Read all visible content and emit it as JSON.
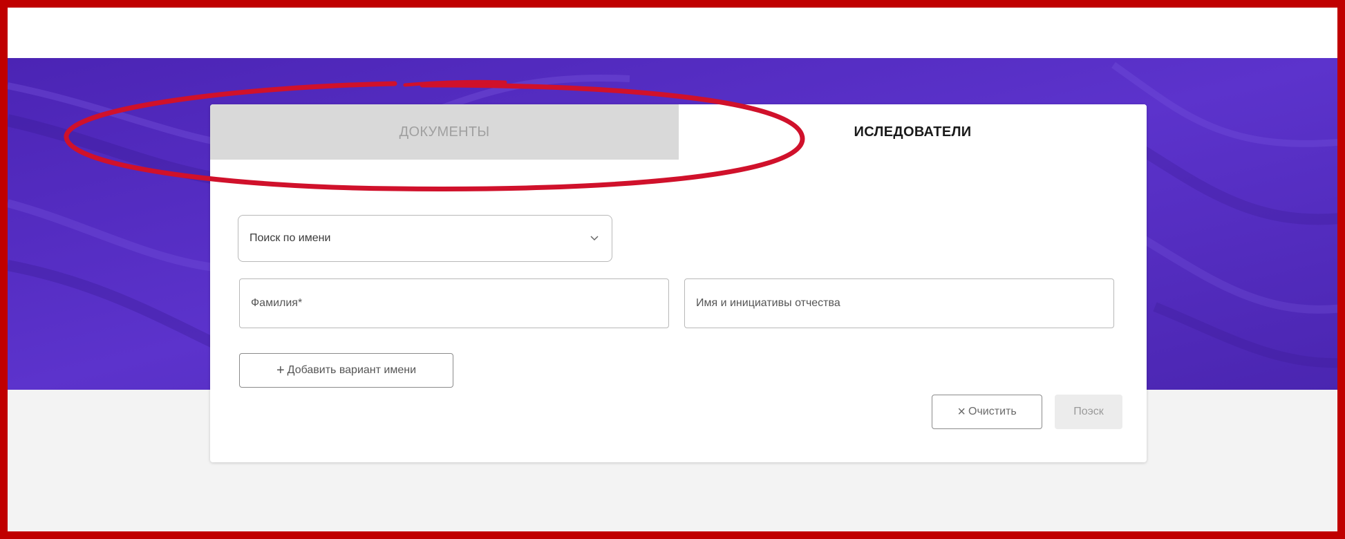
{
  "tabs": {
    "documents": "ДОКУМЕНТЫ",
    "researchers": "ИСЛЕДОВАТЕЛИ",
    "active": "researchers"
  },
  "search_mode": {
    "selected": "Поиск по имени",
    "icon": "chevron-down-icon"
  },
  "fields": {
    "surname_placeholder": "Фамилия*",
    "name_placeholder": "Имя и инициативы отчества"
  },
  "buttons": {
    "add_variant_icon": "+",
    "add_variant_label": "Добавить вариант имени",
    "clear_icon": "×",
    "clear_label": "Очистить",
    "search_label": "Поэск"
  },
  "colors": {
    "hero": "#5a2fc8",
    "frame_border": "#c00000",
    "annotation": "#d0112b",
    "inactive_tab": "#d9d9d9"
  }
}
